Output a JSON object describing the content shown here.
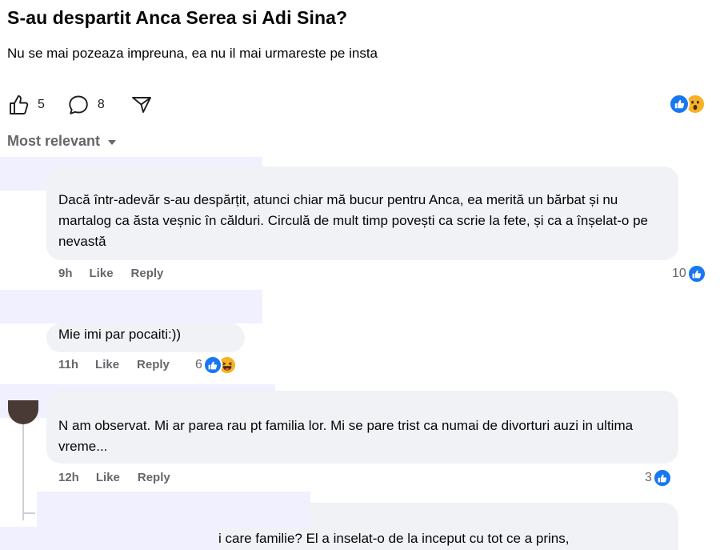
{
  "post": {
    "title": "S-au despartit Anca Serea si Adi Sina?",
    "body": "Nu se mai pozeaza impreuna, ea nu il mai urmareste pe insta",
    "like_count": "5",
    "comment_count": "8",
    "reactions": [
      "like-icon",
      "wow-icon"
    ]
  },
  "sort": {
    "label": "Most relevant"
  },
  "comments": [
    {
      "text": "Dacă într-adevăr s-au despărțit, atunci chiar mă bucur pentru Anca, ea merită un bărbat și nu martalog ca ăsta veșnic în călduri. Circulă de mult timp povești ca scrie la fete, și ca a înșelat-o pe nevastă",
      "time": "9h",
      "like_label": "Like",
      "reply_label": "Reply",
      "reaction_count": "10",
      "reactions": [
        "like-icon"
      ]
    },
    {
      "text": "Mie imi par pocaiti:))",
      "time": "11h",
      "like_label": "Like",
      "reply_label": "Reply",
      "reaction_count": "6",
      "reactions": [
        "like-icon",
        "haha-icon"
      ]
    },
    {
      "text": "N am observat. Mi ar parea rau pt familia lor. Mi se pare trist ca numai de divorturi auzi in ultima vreme...",
      "time": "12h",
      "like_label": "Like",
      "reply_label": "Reply",
      "reaction_count": "3",
      "reactions": [
        "like-icon"
      ]
    },
    {
      "text": "i care familie? El a inselat-o de la inceput cu tot ce a prins,"
    }
  ],
  "colors": {
    "accent": "#1877f2",
    "bubble": "#f0f2f5",
    "muted": "#65676b",
    "reaction_yellow": "#f7b125"
  }
}
